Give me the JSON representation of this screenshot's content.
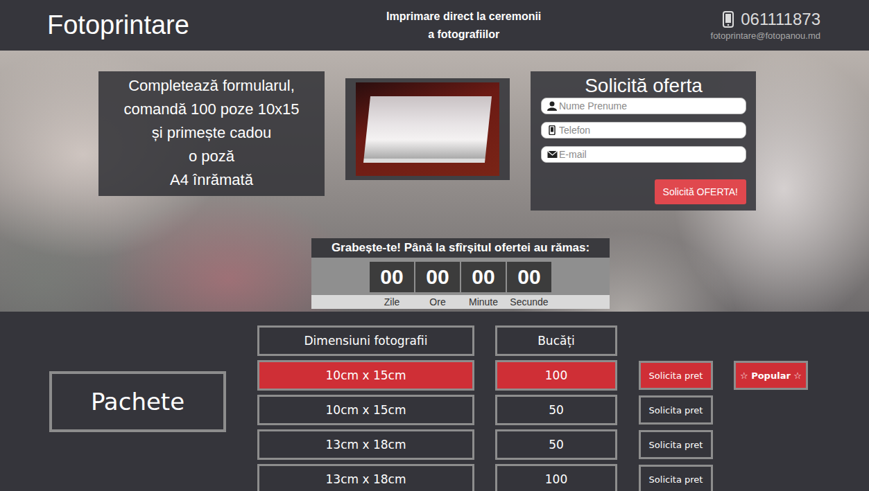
{
  "header": {
    "logo": "Fotoprintare",
    "tagline": [
      "Imprimare direct la ceremonii",
      "a fotografiilor"
    ],
    "phone": "061111873",
    "email": "fotoprintare@fotopanou.md"
  },
  "promo": {
    "lines": [
      "Completează formularul,",
      "comandă 100 poze 10x15",
      "și primește cadou",
      "o poză",
      "A4 înrămată"
    ]
  },
  "form": {
    "title": "Solicită oferta",
    "fields": [
      {
        "kind": "name",
        "placeholder": "Nume Prenume"
      },
      {
        "kind": "phone",
        "placeholder": "Telefon"
      },
      {
        "kind": "email",
        "placeholder": "E-mail"
      }
    ],
    "button": "Solicită OFERTA!"
  },
  "countdown": {
    "title": "Grabește-te! Până la sfîrșitul ofertei au rămas:",
    "units": [
      {
        "value": "00",
        "label": "Zile"
      },
      {
        "value": "00",
        "label": "Ore"
      },
      {
        "value": "00",
        "label": "Minute"
      },
      {
        "value": "00",
        "label": "Secunde"
      }
    ]
  },
  "packages": {
    "title": "Pachete",
    "columns": [
      "Dimensiuni fotografii",
      "Bucăți"
    ],
    "rows": [
      {
        "size": "10cm x 15cm",
        "quantity": "100",
        "button": "Solicita pret",
        "selected": true,
        "badge": "☆ Popular ☆"
      },
      {
        "size": "10cm x 15cm",
        "quantity": "50",
        "button": "Solicita pret",
        "selected": false,
        "badge": ""
      },
      {
        "size": "13cm x 18cm",
        "quantity": "50",
        "button": "Solicita pret",
        "selected": false,
        "badge": ""
      },
      {
        "size": "13cm x 18cm",
        "quantity": "100",
        "button": "Solicita pret",
        "selected": false,
        "badge": ""
      }
    ]
  }
}
